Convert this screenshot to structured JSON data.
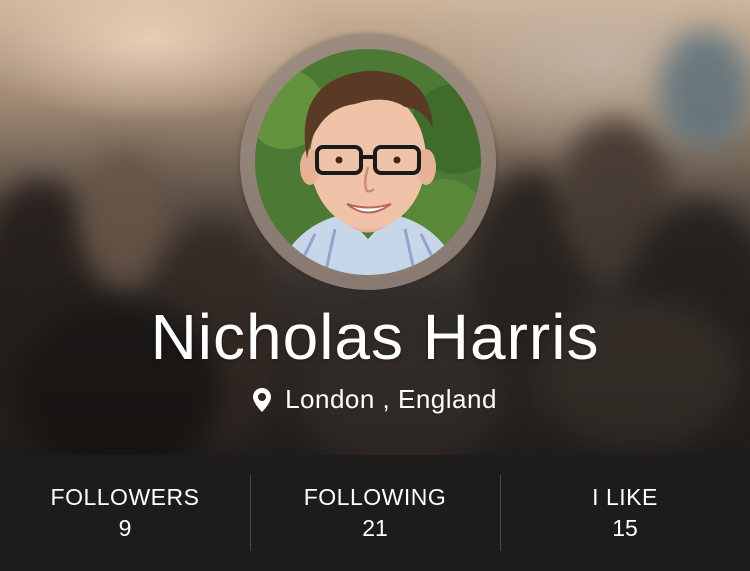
{
  "profile": {
    "name": "Nicholas Harris",
    "location": "London , England",
    "location_icon": "map-pin-icon"
  },
  "stats": [
    {
      "label": "FOLLOWERS",
      "value": "9"
    },
    {
      "label": "FOLLOWING",
      "value": "21"
    },
    {
      "label": "I LIKE",
      "value": "15"
    }
  ],
  "colors": {
    "stats_background": "#1c1c1c",
    "text": "#ffffff",
    "avatar_ring": "#968779"
  }
}
